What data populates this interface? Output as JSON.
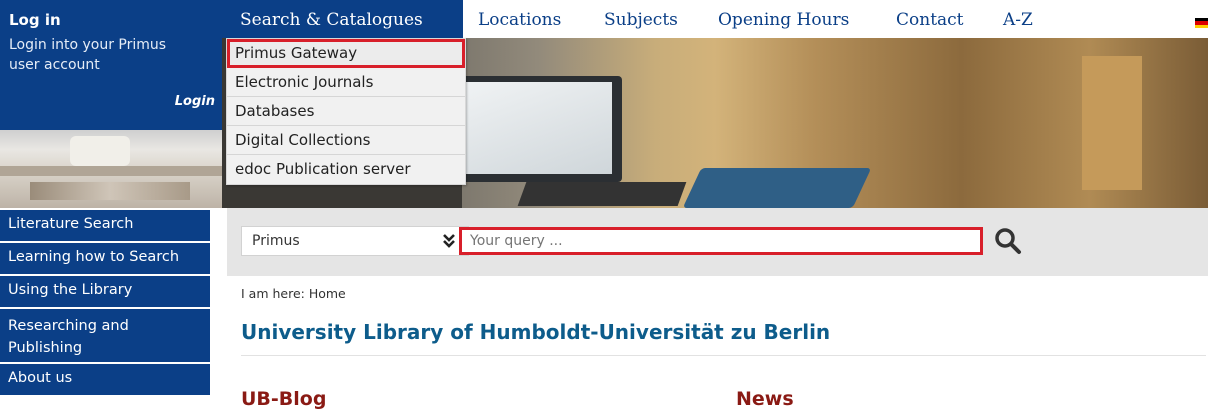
{
  "login": {
    "title": "Log in",
    "description": "Login into your Primus user account",
    "link": "Login"
  },
  "top_nav": {
    "items": [
      {
        "label": "Search & Catalogues"
      },
      {
        "label": "Locations"
      },
      {
        "label": "Subjects"
      },
      {
        "label": "Opening Hours"
      },
      {
        "label": "Contact"
      },
      {
        "label": "A-Z"
      }
    ],
    "flag": "german-flag-icon"
  },
  "dropdown": {
    "items": [
      {
        "label": "Primus Gateway"
      },
      {
        "label": "Electronic Journals"
      },
      {
        "label": "Databases"
      },
      {
        "label": "Digital Collections"
      },
      {
        "label": "edoc Publication server"
      }
    ]
  },
  "side_nav": {
    "items": [
      {
        "label": "Literature Search"
      },
      {
        "label": "Learning how to Search"
      },
      {
        "label": "Using the Library"
      },
      {
        "label": "Researching and Publishing"
      },
      {
        "label": "About us"
      }
    ]
  },
  "search": {
    "select_value": "Primus",
    "placeholder": "Your query ..."
  },
  "breadcrumb": "I am here: Home",
  "page_title": "University Library of Humboldt-Universität zu Berlin",
  "sections": {
    "blog": "UB-Blog",
    "news": "News"
  },
  "colors": {
    "primary": "#0b3f87",
    "highlight": "#d81f2a",
    "title": "#0d5c8b",
    "section": "#8a1a14"
  }
}
